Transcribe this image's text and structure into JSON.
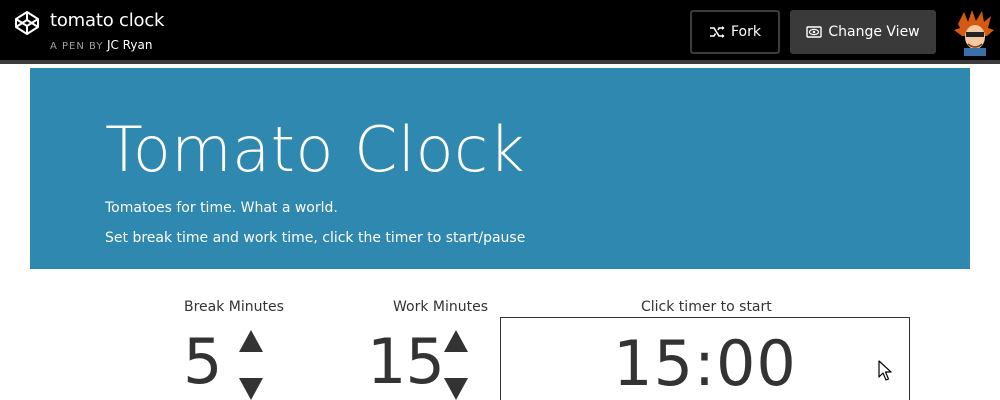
{
  "header": {
    "pen_title": "tomato clock",
    "byline_prefix": "A PEN BY",
    "author": "JC Ryan",
    "fork_label": "Fork",
    "change_view_label": "Change View"
  },
  "hero": {
    "title": "Tomato Clock",
    "line1": "Tomatoes for time. What a world.",
    "line2": "Set break time and work time, click the timer to start/pause"
  },
  "controls": {
    "break": {
      "label": "Break Minutes",
      "value": "5"
    },
    "work": {
      "label": "Work Minutes",
      "value": "15"
    },
    "timer": {
      "label": "Click timer to start",
      "value": "15:00"
    }
  },
  "icons": {
    "logo": "codepen-logo-icon",
    "fork": "fork-icon",
    "view": "eye-icon",
    "up": "arrow-up-icon",
    "down": "arrow-down-icon",
    "cursor": "mouse-pointer-icon"
  },
  "colors": {
    "header_bg": "#000000",
    "hero_bg": "#2e88af",
    "text": "#333333",
    "button_bg": "#3a3a3a"
  }
}
